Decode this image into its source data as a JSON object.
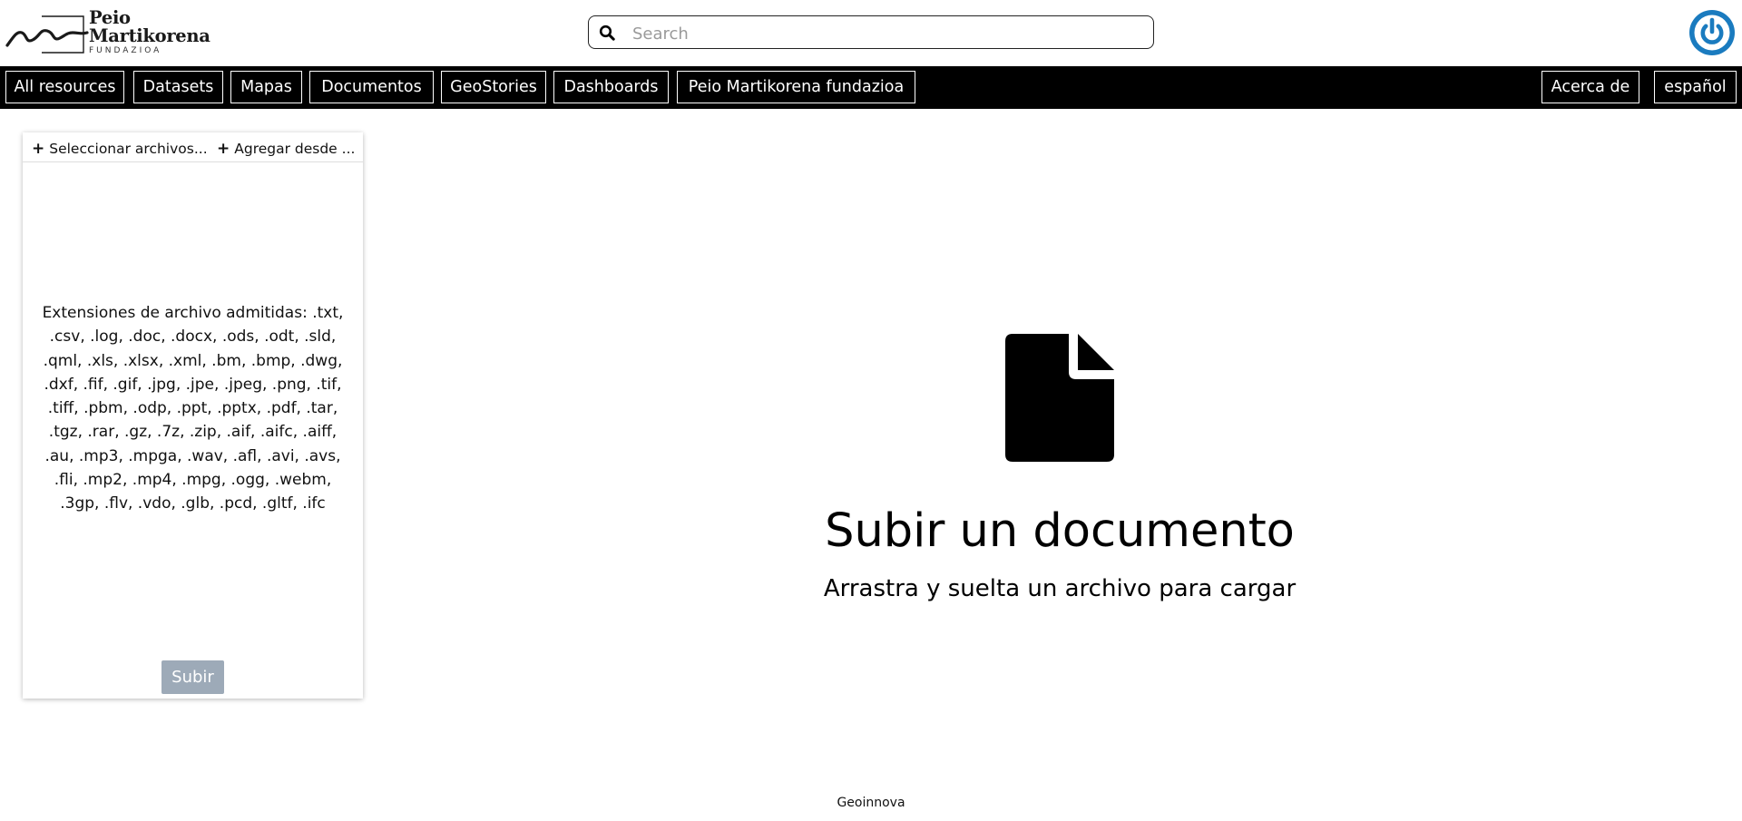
{
  "header": {
    "logo_name_line1": "Peio",
    "logo_name_line2": "Martikorena",
    "logo_sub": "FUNDAZIOA",
    "search_placeholder": "Search",
    "search_icon": "search-icon",
    "user_icon": "power-icon",
    "user_icon_color": "#1a7bbf"
  },
  "nav": {
    "items": [
      {
        "label": "All resources"
      },
      {
        "label": "Datasets"
      },
      {
        "label": "Mapas"
      },
      {
        "label": "Documentos"
      },
      {
        "label": "GeoStories"
      },
      {
        "label": "Dashboards"
      },
      {
        "label": "Peio Martikorena fundazioa"
      }
    ],
    "right_items": [
      {
        "label": "Acerca de"
      },
      {
        "label": "español"
      }
    ]
  },
  "upload_panel": {
    "select_files_label": "Seleccionar archivos...",
    "add_from_label": "Agregar desde ...",
    "extensions_text": "Extensiones de archivo admitidas: .txt, .csv, .log, .doc, .docx, .ods, .odt, .sld, .qml, .xls, .xlsx, .xml, .bm, .bmp, .dwg, .dxf, .fif, .gif, .jpg, .jpe, .jpeg, .png, .tif, .tiff, .pbm, .odp, .ppt, .pptx, .pdf, .tar, .tgz, .rar, .gz, .7z, .zip, .aif, .aifc, .aiff, .au, .mp3, .mpga, .wav, .afl, .avi, .avs, .fli, .mp2, .mp4, .mpg, .ogg, .webm, .3gp, .flv, .vdo, .glb, .pcd, .gltf, .ifc",
    "submit_label": "Subir",
    "submit_color": "#9daab8"
  },
  "main": {
    "icon": "file-icon",
    "title": "Subir un documento",
    "subtitle": "Arrastra y suelta un archivo para cargar"
  },
  "footer": {
    "text": "Geoinnova"
  }
}
